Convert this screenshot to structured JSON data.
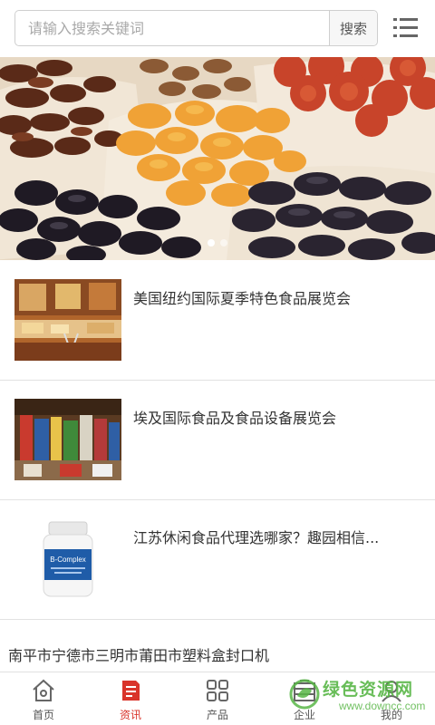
{
  "search": {
    "placeholder": "请输入搜索关键词",
    "button_label": "搜索"
  },
  "banner": {
    "slide_count": 2,
    "active_slide": 1
  },
  "news": [
    {
      "title": "美国纽约国际夏季特色食品展览会"
    },
    {
      "title": "埃及国际食品及食品设备展览会"
    },
    {
      "title": "江苏休闲食品代理选哪家？趣园相信..."
    },
    {
      "title": "南平市宁德市三明市莆田市塑料盒封口机"
    }
  ],
  "product_label": "B-Complex",
  "tabs": [
    {
      "label": "首页",
      "icon": "home-icon"
    },
    {
      "label": "资讯",
      "icon": "news-icon",
      "active": true
    },
    {
      "label": "产品",
      "icon": "grid-icon"
    },
    {
      "label": "企业",
      "icon": "building-icon"
    },
    {
      "label": "我的",
      "icon": "user-icon"
    }
  ],
  "watermark": {
    "text": "绿色资源网",
    "url": "www.downcc.com"
  },
  "colors": {
    "accent": "#d9342b",
    "watermark": "#58b646"
  }
}
